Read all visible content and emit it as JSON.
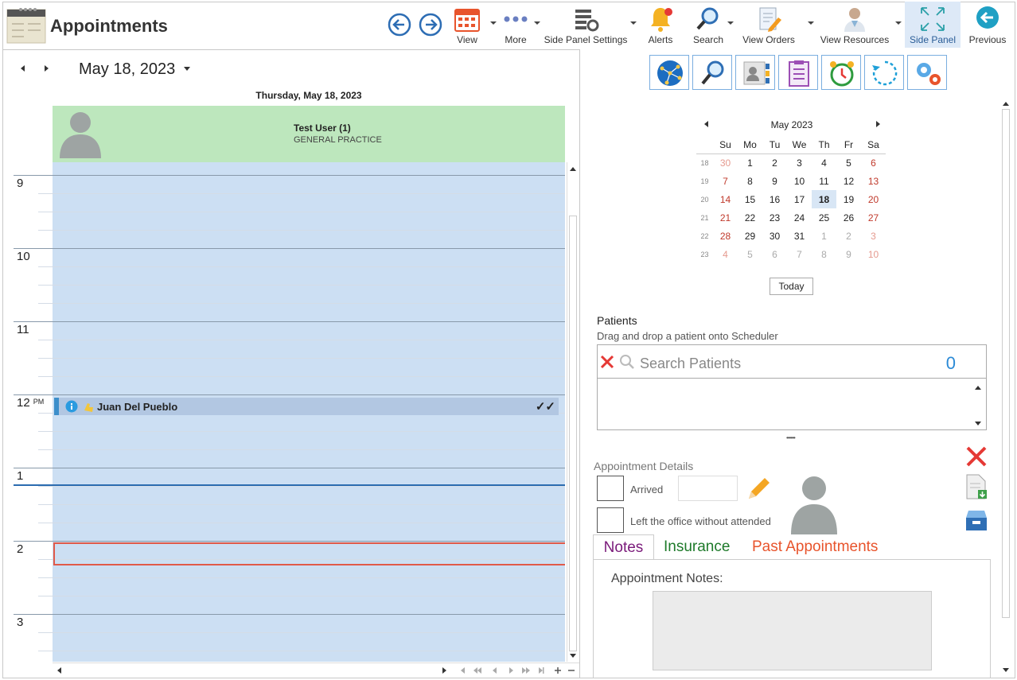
{
  "app": {
    "title": "Appointments"
  },
  "toolbar": {
    "view": "View",
    "more": "More",
    "side_panel_settings": "Side Panel Settings",
    "alerts": "Alerts",
    "search": "Search",
    "view_orders": "View Orders",
    "view_resources": "View Resources",
    "side_panel": "Side Panel",
    "previous": "Previous"
  },
  "scheduler": {
    "date": "May 18, 2023",
    "day_header": "Thursday, May 18, 2023",
    "resource": {
      "name": "Test User (1)",
      "department": "GENERAL PRACTICE"
    },
    "hours": [
      "9",
      "10",
      "11",
      "12",
      "1",
      "2",
      "3"
    ],
    "pm_marker": "PM",
    "appointment": {
      "patient": "Juan Del Pueblo",
      "status": "✓✓"
    }
  },
  "calendar": {
    "month": "May 2023",
    "weekdays": [
      "Su",
      "Mo",
      "Tu",
      "We",
      "Th",
      "Fr",
      "Sa"
    ],
    "weeks": [
      {
        "num": "18",
        "days": [
          "30",
          "1",
          "2",
          "3",
          "4",
          "5",
          "6"
        ]
      },
      {
        "num": "19",
        "days": [
          "7",
          "8",
          "9",
          "10",
          "11",
          "12",
          "13"
        ]
      },
      {
        "num": "20",
        "days": [
          "14",
          "15",
          "16",
          "17",
          "18",
          "19",
          "20"
        ]
      },
      {
        "num": "21",
        "days": [
          "21",
          "22",
          "23",
          "24",
          "25",
          "26",
          "27"
        ]
      },
      {
        "num": "22",
        "days": [
          "28",
          "29",
          "30",
          "31",
          "1",
          "2",
          "3"
        ]
      },
      {
        "num": "23",
        "days": [
          "4",
          "5",
          "6",
          "7",
          "8",
          "9",
          "10"
        ]
      }
    ],
    "selected": "18",
    "today_label": "Today"
  },
  "patients": {
    "title": "Patients",
    "hint": "Drag and drop a patient onto Scheduler",
    "search_placeholder": "Search Patients",
    "count": "0"
  },
  "details": {
    "title": "Appointment Details",
    "arrived": "Arrived",
    "left_office": "Left the office without attended"
  },
  "tabs": {
    "notes": "Notes",
    "insurance": "Insurance",
    "past": "Past Appointments",
    "notes_label": "Appointment Notes:"
  },
  "colors": {
    "accent": "#2b8ad6",
    "resource_header": "#bde7bd",
    "grid": "#ccdff3",
    "selected_border": "#e05a4a"
  }
}
